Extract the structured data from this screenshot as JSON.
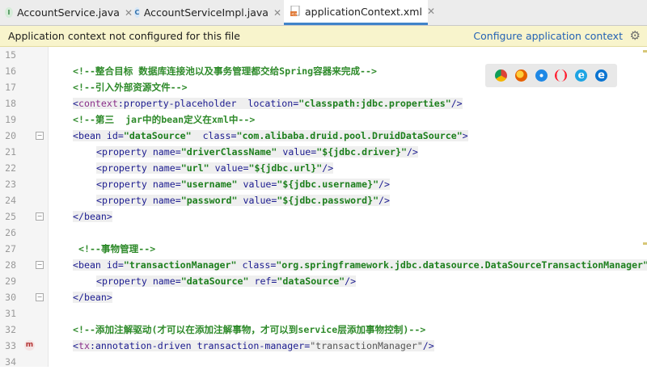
{
  "tabs": [
    {
      "label": "AccountService.java",
      "icon": "I",
      "icon_color": "#5bae6b"
    },
    {
      "label": "AccountServiceImpl.java",
      "icon": "C",
      "icon_color": "#3f8ccc"
    },
    {
      "label": "applicationContext.xml",
      "icon": "xml"
    }
  ],
  "notice": {
    "message": "Application context not configured for this file",
    "action": "Configure application context"
  },
  "browser_icons": [
    "chrome-icon",
    "firefox-icon",
    "safari-icon",
    "opera-icon",
    "ie-icon",
    "edge-icon"
  ],
  "editor": {
    "lines": [
      {
        "num": "15",
        "tokens": []
      },
      {
        "num": "16",
        "tokens": [
          {
            "c": "comment",
            "t": "<!--整合目标 数据库连接池以及事务管理都交给Spring容器来完成-->"
          }
        ]
      },
      {
        "num": "17",
        "tokens": [
          {
            "c": "comment",
            "t": "<!--引入外部资源文件-->"
          }
        ]
      },
      {
        "num": "18",
        "tokens": [
          {
            "c": "tag",
            "t": "<"
          },
          {
            "c": "ns",
            "t": "context"
          },
          {
            "c": "tag",
            "t": ":property-placeholder  "
          },
          {
            "c": "attr",
            "t": "location="
          },
          {
            "c": "str",
            "t": "\"classpath:jdbc.properties\""
          },
          {
            "c": "tag",
            "t": "/>"
          }
        ]
      },
      {
        "num": "19",
        "tokens": [
          {
            "c": "comment",
            "t": "<!--第三  jar中的bean定义在xml中-->"
          }
        ]
      },
      {
        "num": "20",
        "tokens": [
          {
            "c": "tag",
            "t": "<bean "
          },
          {
            "c": "attr",
            "t": "id="
          },
          {
            "c": "str",
            "t": "\"dataSource\""
          },
          {
            "c": "tag",
            "t": "  "
          },
          {
            "c": "attr",
            "t": "class="
          },
          {
            "c": "str",
            "t": "\"com.alibaba.druid.pool.DruidDataSource\""
          },
          {
            "c": "tag",
            "t": ">"
          }
        ]
      },
      {
        "num": "21",
        "indent": true,
        "tokens": [
          {
            "c": "tag",
            "t": "<property "
          },
          {
            "c": "attr",
            "t": "name="
          },
          {
            "c": "str",
            "t": "\"driverClassName\""
          },
          {
            "c": "tag",
            "t": " "
          },
          {
            "c": "attr",
            "t": "value="
          },
          {
            "c": "str",
            "t": "\"${jdbc.driver}\""
          },
          {
            "c": "tag",
            "t": "/>"
          }
        ]
      },
      {
        "num": "22",
        "indent": true,
        "tokens": [
          {
            "c": "tag",
            "t": "<property "
          },
          {
            "c": "attr",
            "t": "name="
          },
          {
            "c": "str",
            "t": "\"url\""
          },
          {
            "c": "tag",
            "t": " "
          },
          {
            "c": "attr",
            "t": "value="
          },
          {
            "c": "str",
            "t": "\"${jdbc.url}\""
          },
          {
            "c": "tag",
            "t": "/>"
          }
        ]
      },
      {
        "num": "23",
        "indent": true,
        "tokens": [
          {
            "c": "tag",
            "t": "<property "
          },
          {
            "c": "attr",
            "t": "name="
          },
          {
            "c": "str",
            "t": "\"username\""
          },
          {
            "c": "tag",
            "t": " "
          },
          {
            "c": "attr",
            "t": "value="
          },
          {
            "c": "str",
            "t": "\"${jdbc.username}\""
          },
          {
            "c": "tag",
            "t": "/>"
          }
        ]
      },
      {
        "num": "24",
        "indent": true,
        "tokens": [
          {
            "c": "tag",
            "t": "<property "
          },
          {
            "c": "attr",
            "t": "name="
          },
          {
            "c": "str",
            "t": "\"password\""
          },
          {
            "c": "tag",
            "t": " "
          },
          {
            "c": "attr",
            "t": "value="
          },
          {
            "c": "str",
            "t": "\"${jdbc.password}\""
          },
          {
            "c": "tag",
            "t": "/>"
          }
        ]
      },
      {
        "num": "25",
        "tokens": [
          {
            "c": "tag",
            "t": "</bean>"
          }
        ]
      },
      {
        "num": "26",
        "tokens": []
      },
      {
        "num": "27",
        "tokens": [
          {
            "c": "comment",
            "t": " <!--事物管理-->"
          }
        ]
      },
      {
        "num": "28",
        "tokens": [
          {
            "c": "tag",
            "t": "<bean "
          },
          {
            "c": "attr",
            "t": "id="
          },
          {
            "c": "str",
            "t": "\"transactionManager\""
          },
          {
            "c": "tag",
            "t": " "
          },
          {
            "c": "attr",
            "t": "class="
          },
          {
            "c": "str",
            "t": "\"org.springframework.jdbc.datasource.DataSourceTransactionManager\""
          }
        ]
      },
      {
        "num": "29",
        "indent": true,
        "tokens": [
          {
            "c": "tag",
            "t": "<property "
          },
          {
            "c": "attr",
            "t": "name="
          },
          {
            "c": "str",
            "t": "\"dataSource\""
          },
          {
            "c": "tag",
            "t": " "
          },
          {
            "c": "attr",
            "t": "ref="
          },
          {
            "c": "str",
            "t": "\"dataSource\""
          },
          {
            "c": "tag",
            "t": "/>"
          }
        ]
      },
      {
        "num": "30",
        "tokens": [
          {
            "c": "tag",
            "t": "</bean>"
          }
        ]
      },
      {
        "num": "31",
        "tokens": []
      },
      {
        "num": "32",
        "tokens": [
          {
            "c": "comment",
            "t": "<!--添加注解驱动(才可以在添加注解事物，才可以到service层添加事物控制)-->"
          }
        ]
      },
      {
        "num": "33",
        "tokens": [
          {
            "c": "tag",
            "t": "<"
          },
          {
            "c": "ns",
            "t": "tx"
          },
          {
            "c": "tag",
            "t": ":annotation-driven "
          },
          {
            "c": "attr",
            "t": "transaction-manager="
          },
          {
            "c": "strgray",
            "t": "\"transactionManager\""
          },
          {
            "c": "tag",
            "t": "/>"
          }
        ]
      },
      {
        "num": "34",
        "tokens": []
      }
    ]
  }
}
